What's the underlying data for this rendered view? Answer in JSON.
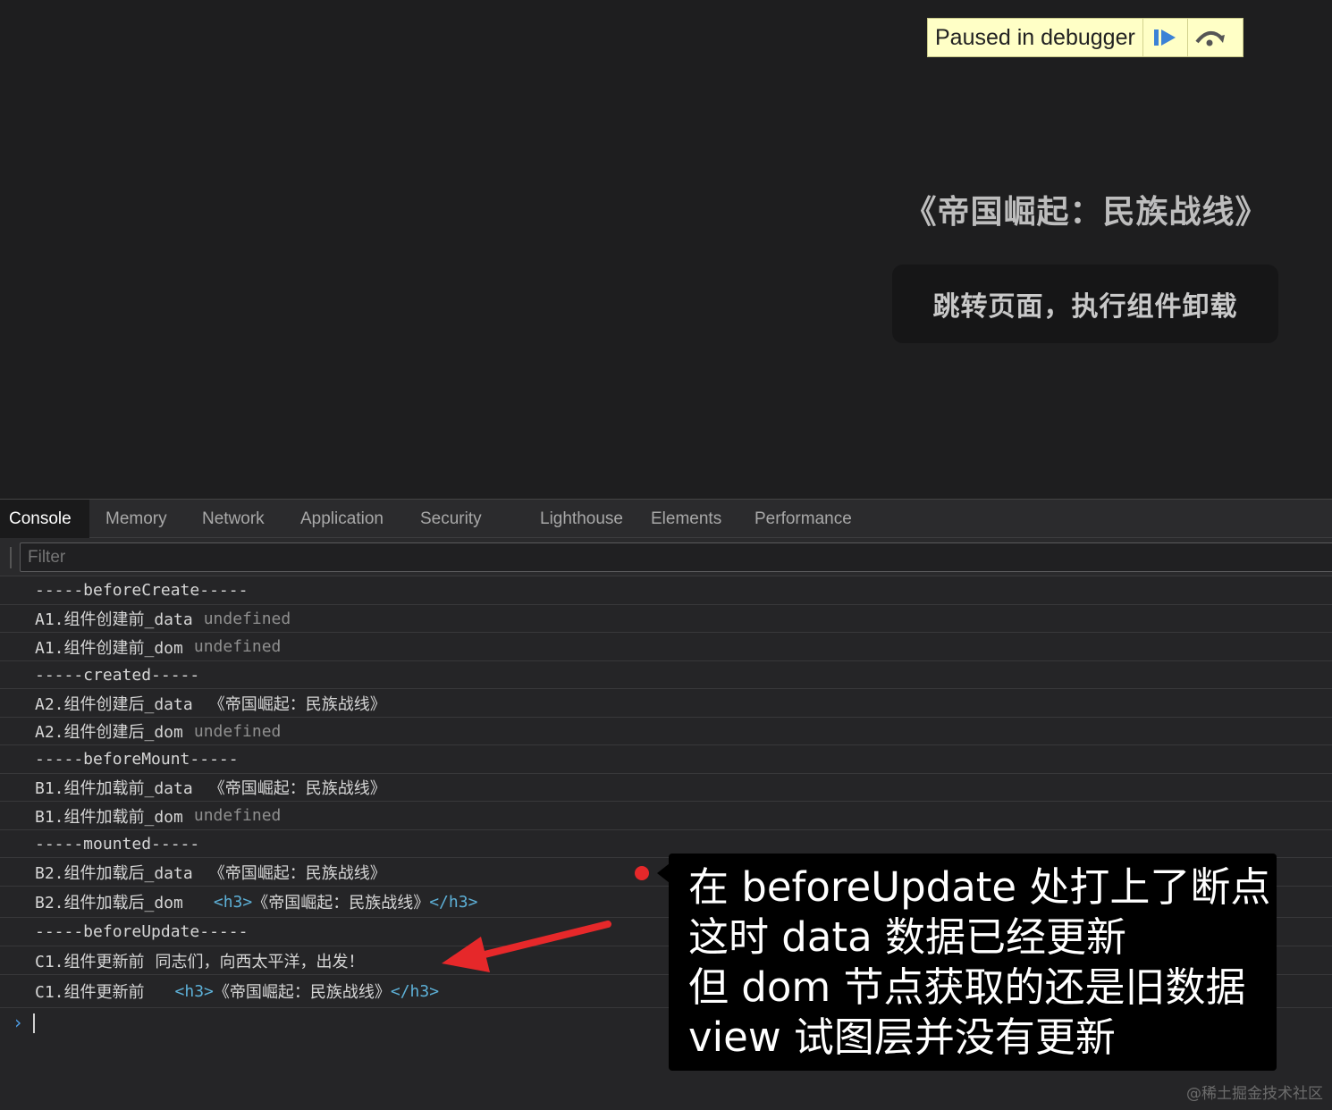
{
  "page": {
    "debugger_banner": "Paused in debugger",
    "resume_icon": "resume-icon",
    "step_over_icon": "step-over-icon",
    "title": "《帝国崛起：民族战线》",
    "unmount_button": "跳转页面，执行组件卸载"
  },
  "devtools": {
    "tabs": [
      {
        "label": "Console",
        "active": true
      },
      {
        "label": "Memory",
        "active": false
      },
      {
        "label": "Network",
        "active": false
      },
      {
        "label": "Application",
        "active": false
      },
      {
        "label": "Security",
        "active": false
      },
      {
        "label": "Lighthouse",
        "active": false
      },
      {
        "label": "Elements",
        "active": false
      },
      {
        "label": "Performance",
        "active": false
      }
    ],
    "filter_placeholder": "Filter",
    "console_lines": [
      {
        "text": "-----beforeCreate-----"
      },
      {
        "text": "A1.组件创建前_data",
        "value": "undefined"
      },
      {
        "text": "A1.组件创建前_dom",
        "value": "undefined"
      },
      {
        "text": "-----created-----"
      },
      {
        "text": "A2.组件创建后_data",
        "value": "《帝国崛起：民族战线》"
      },
      {
        "text": "A2.组件创建后_dom",
        "value": "undefined"
      },
      {
        "text": "-----beforeMount-----"
      },
      {
        "text": "B1.组件加载前_data",
        "value": "《帝国崛起：民族战线》"
      },
      {
        "text": "B1.组件加载前_dom",
        "value": "undefined"
      },
      {
        "text": "-----mounted-----"
      },
      {
        "text": "B2.组件加载后_data",
        "value": "《帝国崛起：民族战线》"
      },
      {
        "text": "B2.组件加载后_dom",
        "tag_open": "<h3>",
        "value": "《帝国崛起：民族战线》",
        "tag_close": "</h3>"
      },
      {
        "text": "-----beforeUpdate-----"
      },
      {
        "text": "C1.组件更新前",
        "value": "同志们，向西太平洋，出发！"
      },
      {
        "text": "C1.组件更新前",
        "tag_open": "<h3>",
        "value": "《帝国崛起：民族战线》",
        "tag_close": "</h3>"
      }
    ],
    "prompt_symbol": "›"
  },
  "annotation": {
    "lines": [
      "在 beforeUpdate 处打上了断点",
      "这时 data 数据已经更新",
      "但 dom 节点获取的还是旧数据",
      "view 试图层并没有更新"
    ],
    "arrow_color": "#e6282a"
  },
  "watermark": "@稀土掘金技术社区"
}
